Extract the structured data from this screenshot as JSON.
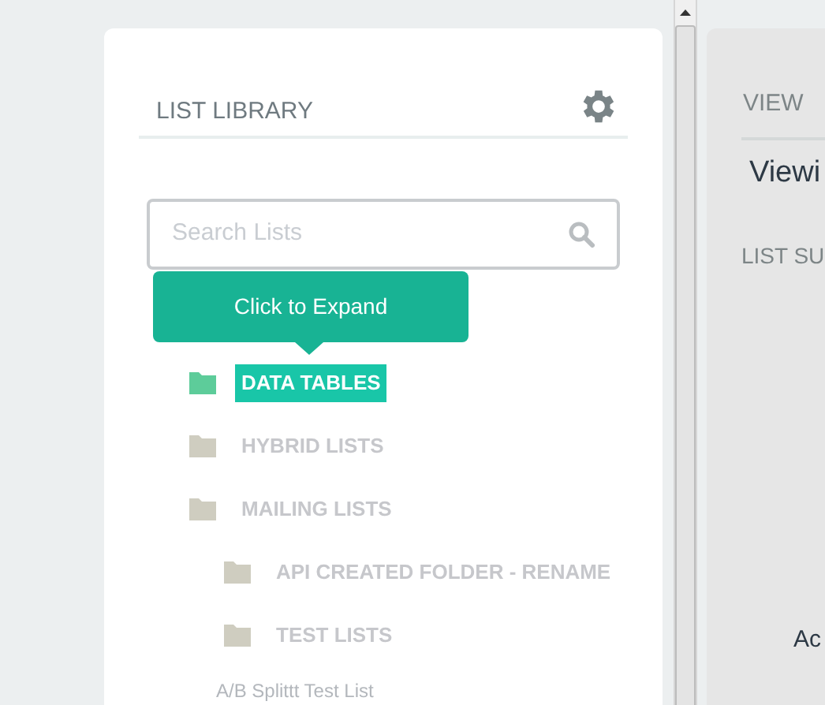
{
  "library": {
    "title": "LIST LIBRARY",
    "search": {
      "placeholder": "Search Lists"
    },
    "tooltip": "Click to Expand",
    "folders": [
      {
        "label": "DATA TABLES",
        "selected": true
      },
      {
        "label": "HYBRID LISTS",
        "selected": false
      },
      {
        "label": "MAILING LISTS",
        "selected": false,
        "children": [
          {
            "label": "API CREATED FOLDER - RENAME",
            "selected": false
          },
          {
            "label": "TEST LISTS",
            "selected": false
          }
        ]
      }
    ],
    "lists": [
      "A/B Splittt Test List"
    ]
  },
  "view_panel": {
    "heading": "VIEW",
    "title": "Viewi",
    "section": "LIST SU",
    "footer_text": "Ac"
  }
}
